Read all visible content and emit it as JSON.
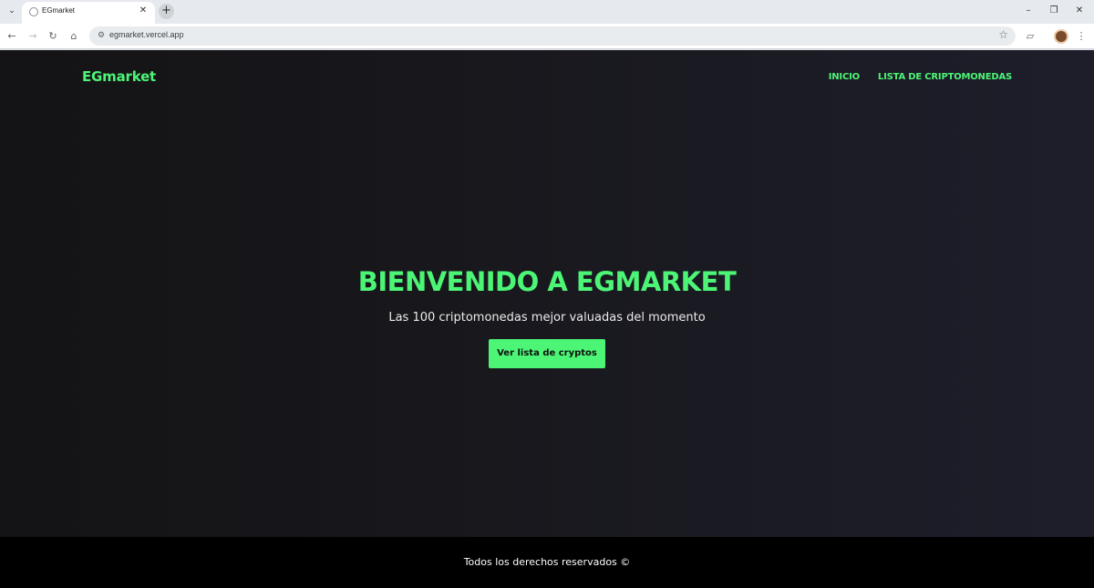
{
  "browser": {
    "tab_title": "EGmarket",
    "url": "egmarket.vercel.app",
    "tab_menu_icon": "chevron-down-icon",
    "tab_close_icon": "close-icon",
    "new_tab_icon": "plus-icon",
    "window_controls": [
      "minimize-icon",
      "restore-icon",
      "close-icon"
    ],
    "nav_icons": [
      "back-arrow-icon",
      "forward-arrow-icon",
      "reload-icon",
      "home-icon"
    ],
    "toolbar_icons": [
      "bookmark-star-icon",
      "extensions-icon",
      "profile-avatar",
      "kebab-menu-icon"
    ]
  },
  "site": {
    "logo": "EGmarket",
    "nav": {
      "home": "INICIO",
      "crypto_list": "LISTA DE CRIPTOMONEDAS"
    },
    "hero": {
      "title": "BIENVENIDO A EGMARKET",
      "subtitle": "Las 100 criptomonedas mejor valuadas del momento",
      "cta_label": "Ver lista de cryptos"
    },
    "footer": {
      "text": "Todos los derechos reservados ©"
    }
  },
  "colors": {
    "accent": "#4cf576",
    "background_left": "#141416",
    "background_right": "#1e1e2b",
    "footer_background": "#000000"
  }
}
